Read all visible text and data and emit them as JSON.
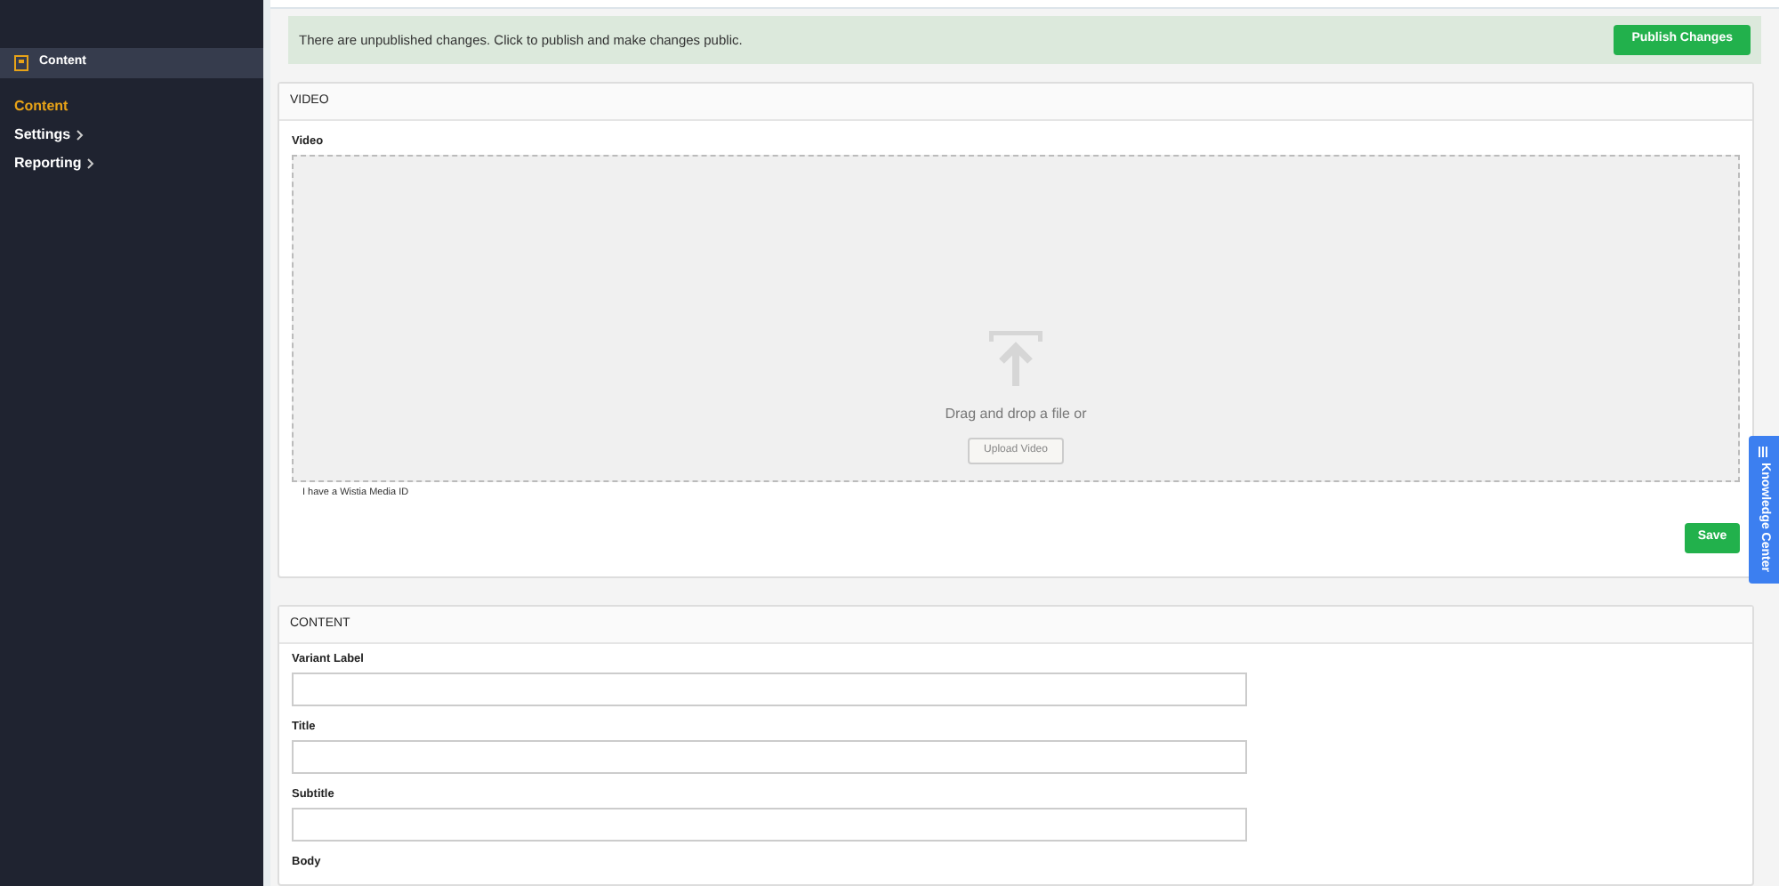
{
  "sidebar": {
    "header": {
      "label": "Content"
    },
    "items": [
      {
        "label": "Content",
        "selected": true,
        "has_submenu": false
      },
      {
        "label": "Settings",
        "selected": false,
        "has_submenu": true
      },
      {
        "label": "Reporting",
        "selected": false,
        "has_submenu": true
      }
    ]
  },
  "banner": {
    "message": "There are unpublished changes. Click to publish and make changes public.",
    "button": "Publish Changes"
  },
  "video_section": {
    "title": "VIDEO",
    "field_label": "Video",
    "dropzone_text": "Drag and drop a file or",
    "upload_button": "Upload Video",
    "wistia_link": "I have a Wistia Media ID",
    "save_button": "Save"
  },
  "content_section": {
    "title": "CONTENT",
    "fields": [
      {
        "label": "Variant Label"
      },
      {
        "label": "Title"
      },
      {
        "label": "Subtitle"
      },
      {
        "label": "Body"
      }
    ]
  },
  "knowledge_tab": {
    "label": "Knowledge Center"
  }
}
